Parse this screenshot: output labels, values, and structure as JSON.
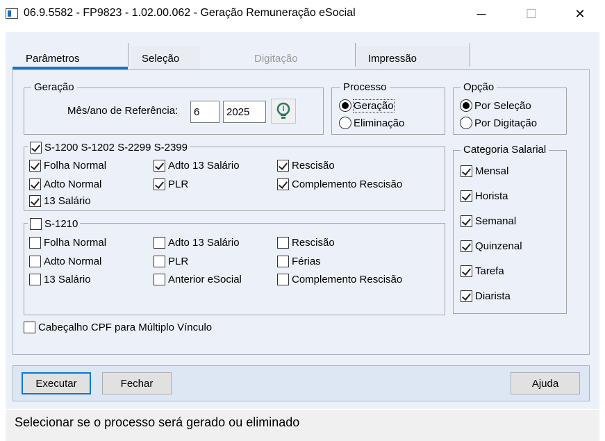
{
  "window": {
    "title": "06.9.5582 - FP9823 - 1.02.00.062 - Geração Remuneração eSocial",
    "minimize_glyph": "─",
    "maximize_glyph": "☐",
    "close_glyph": "✕"
  },
  "tabs": [
    {
      "label": "Parâmetros",
      "active": true
    },
    {
      "label": "Seleção",
      "active": false
    },
    {
      "label": "Digitação",
      "active": false,
      "disabled": true
    },
    {
      "label": "Impressão",
      "active": false
    }
  ],
  "geracao": {
    "legend": "Geração",
    "ref_label": "Mês/ano de Referência:",
    "month_value": "6",
    "year_value": "2025",
    "lookup_icon": "lightbulb-icon"
  },
  "processo": {
    "legend": "Processo",
    "options": [
      {
        "label": "Geração",
        "selected": true
      },
      {
        "label": "Eliminação",
        "selected": false
      }
    ]
  },
  "opcao": {
    "legend": "Opção",
    "options": [
      {
        "label": "Por Seleção",
        "selected": true
      },
      {
        "label": "Por Digitação",
        "selected": false
      }
    ]
  },
  "s1200": {
    "legend": "S-1200 S-1202 S-2299 S-2399",
    "checked": true,
    "items": [
      {
        "label": "Folha Normal",
        "checked": true
      },
      {
        "label": "Adto 13 Salário",
        "checked": true
      },
      {
        "label": "Rescisão",
        "checked": true
      },
      {
        "label": "Adto Normal",
        "checked": true
      },
      {
        "label": "PLR",
        "checked": true
      },
      {
        "label": "Complemento Rescisão",
        "checked": true
      },
      {
        "label": "13 Salário",
        "checked": true
      }
    ]
  },
  "s1210": {
    "legend": "S-1210",
    "checked": false,
    "items": [
      {
        "label": "Folha Normal",
        "checked": false
      },
      {
        "label": "Adto 13 Salário",
        "checked": false
      },
      {
        "label": "Rescisão",
        "checked": false
      },
      {
        "label": "Adto Normal",
        "checked": false
      },
      {
        "label": "PLR",
        "checked": false
      },
      {
        "label": "Férias",
        "checked": false
      },
      {
        "label": "13 Salário",
        "checked": false
      },
      {
        "label": "Anterior eSocial",
        "checked": false
      },
      {
        "label": "Complemento Rescisão",
        "checked": false
      }
    ]
  },
  "categoria": {
    "legend": "Categoria Salarial",
    "items": [
      {
        "label": "Mensal",
        "checked": true
      },
      {
        "label": "Horista",
        "checked": true
      },
      {
        "label": "Semanal",
        "checked": true
      },
      {
        "label": "Quinzenal",
        "checked": true
      },
      {
        "label": "Tarefa",
        "checked": true
      },
      {
        "label": "Diarista",
        "checked": true
      }
    ]
  },
  "cabecalho": {
    "label": "Cabeçalho CPF para Múltiplo Vínculo",
    "checked": false
  },
  "buttons": {
    "executar": "Executar",
    "fechar": "Fechar",
    "ajuda": "Ajuda"
  },
  "status": "Selecionar se o processo será gerado ou eliminado"
}
